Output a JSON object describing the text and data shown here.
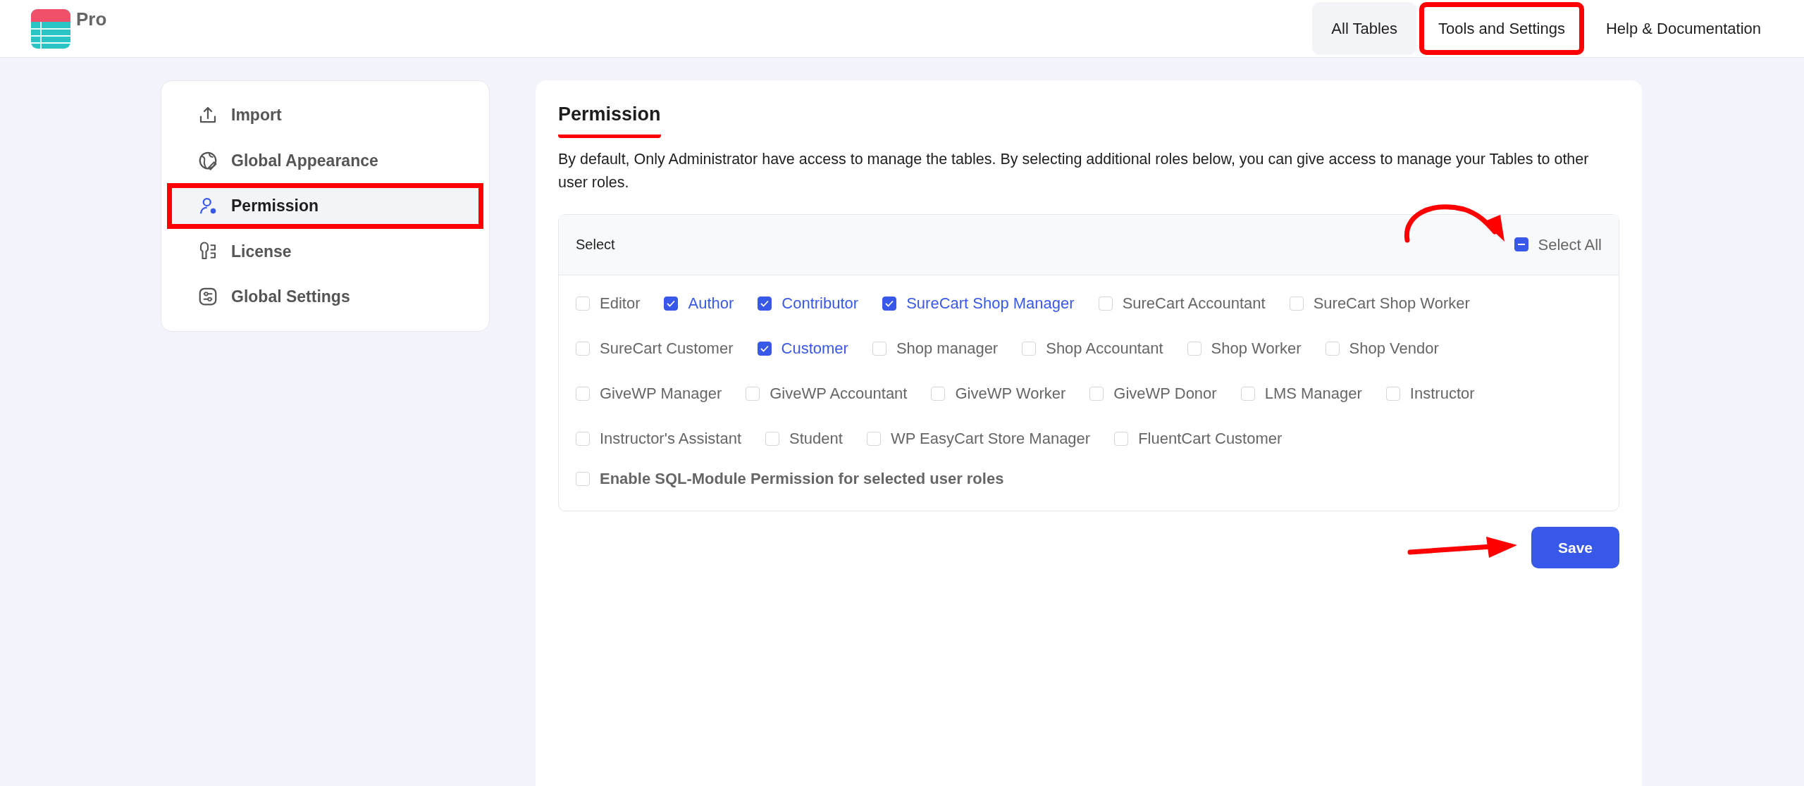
{
  "brand": {
    "label": "Pro"
  },
  "nav": [
    {
      "label": "All Tables",
      "selected": true,
      "highlighted": false
    },
    {
      "label": "Tools and Settings",
      "selected": false,
      "highlighted": true
    },
    {
      "label": "Help & Documentation",
      "selected": false,
      "highlighted": false
    }
  ],
  "sidebar": {
    "items": [
      {
        "label": "Import",
        "selected": false,
        "highlighted": false
      },
      {
        "label": "Global Appearance",
        "selected": false,
        "highlighted": false
      },
      {
        "label": "Permission",
        "selected": true,
        "highlighted": true
      },
      {
        "label": "License",
        "selected": false,
        "highlighted": false
      },
      {
        "label": "Global Settings",
        "selected": false,
        "highlighted": false
      }
    ]
  },
  "panel": {
    "title": "Permission",
    "title_underlined": true,
    "description": "By default, Only Administrator have access to manage the tables. By selecting additional roles below, you can give access to manage your Tables to other user roles.",
    "select_label": "Select",
    "select_all": {
      "label": "Select All",
      "indeterminate": true,
      "arrow": true
    },
    "role_rows": [
      [
        {
          "label": "Editor",
          "checked": false
        },
        {
          "label": "Author",
          "checked": true
        },
        {
          "label": "Contributor",
          "checked": true
        },
        {
          "label": "SureCart Shop Manager",
          "checked": true
        },
        {
          "label": "SureCart Accountant",
          "checked": false
        },
        {
          "label": "SureCart Shop Worker",
          "checked": false
        }
      ],
      [
        {
          "label": "SureCart Customer",
          "checked": false
        },
        {
          "label": "Customer",
          "checked": true
        },
        {
          "label": "Shop manager",
          "checked": false
        },
        {
          "label": "Shop Accountant",
          "checked": false
        },
        {
          "label": "Shop Worker",
          "checked": false
        },
        {
          "label": "Shop Vendor",
          "checked": false
        }
      ],
      [
        {
          "label": "GiveWP Manager",
          "checked": false
        },
        {
          "label": "GiveWP Accountant",
          "checked": false
        },
        {
          "label": "GiveWP Worker",
          "checked": false
        },
        {
          "label": "GiveWP Donor",
          "checked": false
        },
        {
          "label": "LMS Manager",
          "checked": false
        },
        {
          "label": "Instructor",
          "checked": false
        }
      ],
      [
        {
          "label": "Instructor's Assistant",
          "checked": false
        },
        {
          "label": "Student",
          "checked": false
        },
        {
          "label": "WP EasyCart Store Manager",
          "checked": false
        },
        {
          "label": "FluentCart Customer",
          "checked": false
        }
      ]
    ],
    "sql_option": {
      "label": "Enable SQL-Module Permission for selected user roles",
      "checked": false
    },
    "save_button": {
      "label": "Save",
      "arrow": true
    }
  }
}
